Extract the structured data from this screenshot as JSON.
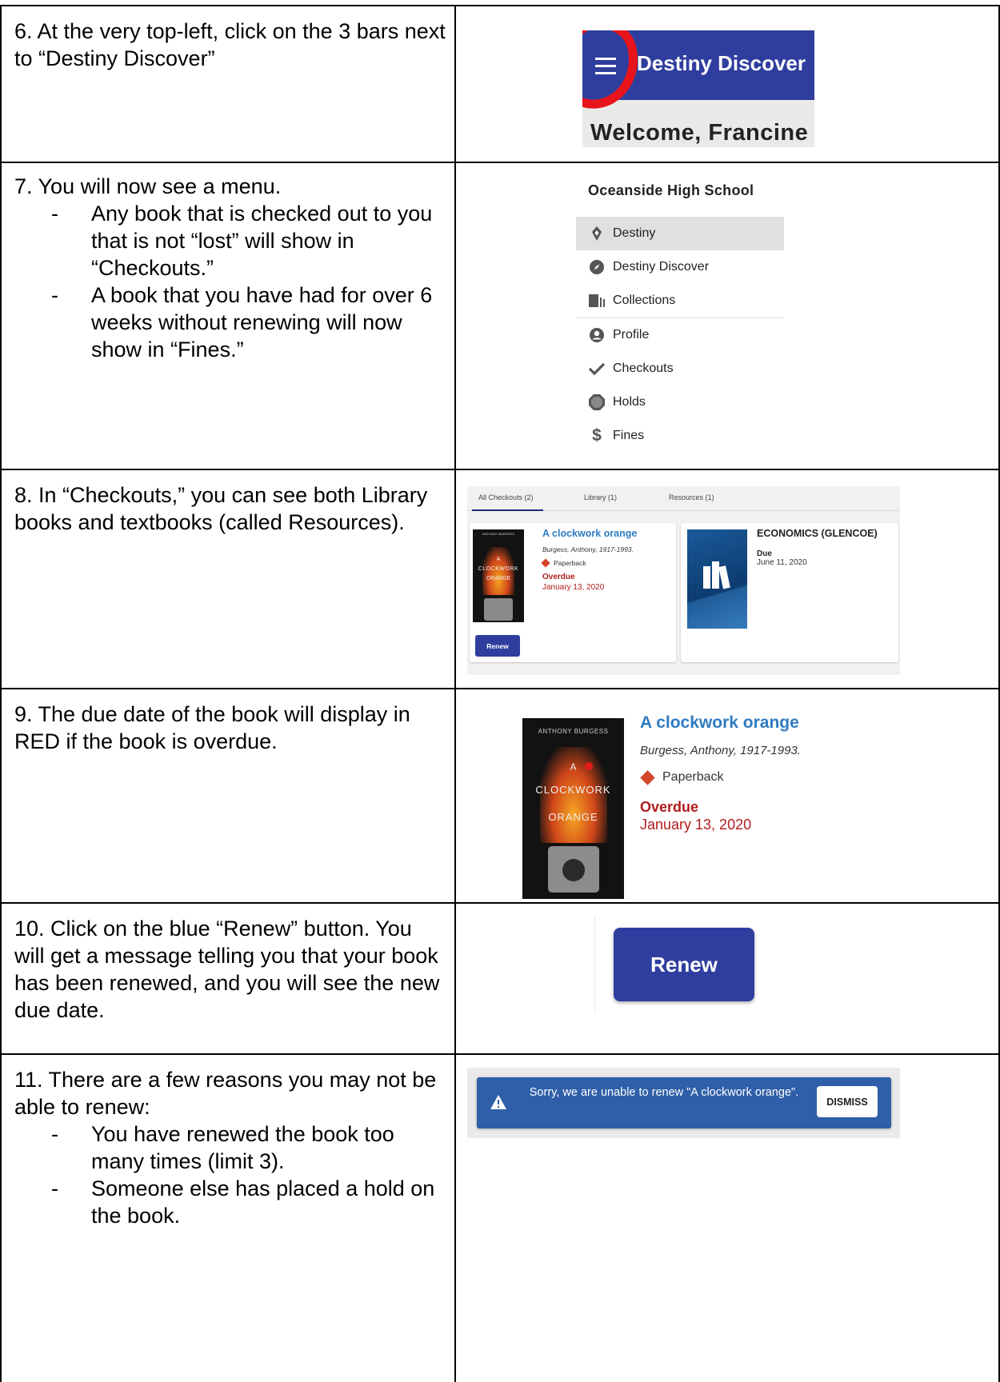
{
  "rows": {
    "r6": {
      "text": "6. At the very top-left, click on the 3 bars next to “Destiny Discover”"
    },
    "r7": {
      "intro": "7. You will now see a menu.",
      "bullets": [
        "Any book that is checked out to you that is not “lost” will show in “Checkouts.”",
        "A book that you have had for over 6 weeks without renewing will now show in “Fines.”"
      ]
    },
    "r8": {
      "text": "8. In “Checkouts,” you can see both Library books and textbooks (called Resources)."
    },
    "r9": {
      "text": "9. The due date of the book will display in RED  if the book is overdue."
    },
    "r10": {
      "text": "10. Click on the blue “Renew” button. You will get a message telling you that your book has been renewed, and you will see the new due date."
    },
    "r11": {
      "intro": "11. There are a few reasons you may not be able to renew:",
      "bullets": [
        "You have renewed the book too many times (limit 3).",
        "Someone else has placed a hold on the book."
      ]
    }
  },
  "header_shot": {
    "brand": "Destiny Discover",
    "welcome": "Welcome, Francine",
    "bar_color": "#2f3e9e",
    "highlight_color": "#e8141b"
  },
  "menu_shot": {
    "school": "Oceanside High School",
    "items": [
      {
        "label": "Destiny",
        "icon": "destiny-logo-icon"
      },
      {
        "label": "Destiny Discover",
        "icon": "compass-icon"
      },
      {
        "label": "Collections",
        "icon": "collections-icon"
      },
      {
        "label": "Profile",
        "icon": "account-circle-icon"
      },
      {
        "label": "Checkouts",
        "icon": "checkmark-icon"
      },
      {
        "label": "Holds",
        "icon": "octagon-icon"
      },
      {
        "label": "Fines",
        "icon": "dollar-icon"
      }
    ]
  },
  "checkouts_shot": {
    "tabs": [
      "All Checkouts (2)",
      "Library (1)",
      "Resources (1)"
    ],
    "book": {
      "title": "A clockwork orange",
      "author": "Burgess, Anthony, 1917-1993.",
      "format": "Paperback",
      "status": "Overdue",
      "date": "January 13, 2020",
      "cover_author": "ANTHONY BURGESS",
      "cover_a": "A",
      "cover_line1": "CLOCKWORK",
      "cover_line2": "ORANGE"
    },
    "renew_label": "Renew",
    "resource": {
      "title": "ECONOMICS (GLENCOE)",
      "status": "Due",
      "date": "June 11, 2020"
    }
  },
  "detail_shot": {
    "title": "A clockwork orange",
    "author": "Burgess, Anthony, 1917-1993.",
    "format": "Paperback",
    "status": "Overdue",
    "date": "January 13, 2020",
    "cover_author": "ANTHONY BURGESS",
    "cover_a": "A",
    "cover_line1": "CLOCKWORK",
    "cover_line2": "ORANGE"
  },
  "renew_shot": {
    "label": "Renew"
  },
  "alert_shot": {
    "message": "Sorry, we are unable to renew \"A clockwork orange\".",
    "dismiss": "DISMISS",
    "color": "#2f5fa8"
  }
}
